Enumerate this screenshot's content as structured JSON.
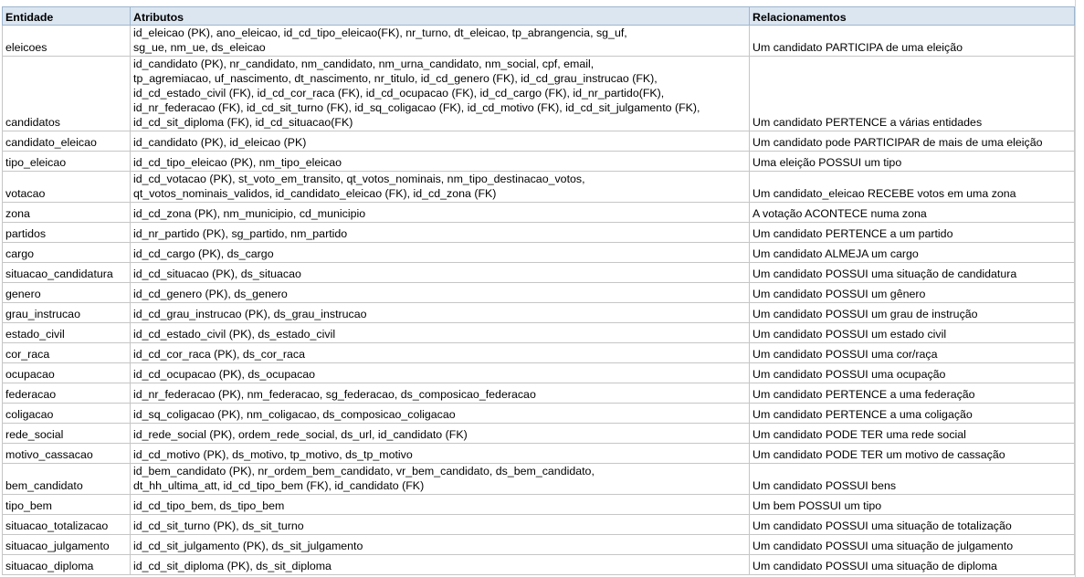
{
  "header": {
    "entity": "Entidade",
    "attributes": "Atributos",
    "relationships": "Relacionamentos"
  },
  "rows": [
    {
      "entity": "eleicoes",
      "attributes": [
        "id_eleicao (PK), ano_eleicao, id_cd_tipo_eleicao(FK), nr_turno, dt_eleicao, tp_abrangencia, sg_uf,",
        "sg_ue, nm_ue, ds_eleicao"
      ],
      "relationship": "Um candidato PARTICIPA de uma eleição"
    },
    {
      "entity": "candidatos",
      "attributes": [
        "id_candidato (PK), nr_candidato, nm_candidato, nm_urna_candidato, nm_social, cpf, email,",
        "tp_agremiacao, uf_nascimento, dt_nascimento, nr_titulo, id_cd_genero (FK), id_cd_grau_instrucao (FK),",
        "id_cd_estado_civil (FK), id_cd_cor_raca (FK), id_cd_ocupacao (FK), id_cd_cargo (FK), id_nr_partido(FK),",
        "id_nr_federacao (FK), id_cd_sit_turno (FK), id_sq_coligacao (FK), id_cd_motivo (FK), id_cd_sit_julgamento (FK),",
        "id_cd_sit_diploma (FK), id_cd_situacao(FK)"
      ],
      "relationship": "Um candidato PERTENCE a várias entidades"
    },
    {
      "entity": "candidato_eleicao",
      "attributes": [
        "id_candidato (PK), id_eleicao (PK)"
      ],
      "relationship": "Um candidato pode PARTICIPAR de mais de uma eleição"
    },
    {
      "entity": "tipo_eleicao",
      "attributes": [
        "id_cd_tipo_eleicao (PK), nm_tipo_eleicao"
      ],
      "relationship": "Uma eleição POSSUI um tipo"
    },
    {
      "entity": "votacao",
      "attributes": [
        "id_cd_votacao (PK),  st_voto_em_transito, qt_votos_nominais, nm_tipo_destinacao_votos,",
        "qt_votos_nominais_validos, id_candidato_eleicao (FK), id_cd_zona (FK)"
      ],
      "relationship": "Um candidato_eleicao RECEBE votos em uma zona"
    },
    {
      "entity": "zona",
      "attributes": [
        "id_cd_zona (PK), nm_municipio, cd_municipio"
      ],
      "relationship": "A votação ACONTECE numa zona"
    },
    {
      "entity": "partidos",
      "attributes": [
        "id_nr_partido (PK), sg_partido, nm_partido"
      ],
      "relationship": "Um candidato PERTENCE a um partido"
    },
    {
      "entity": "cargo",
      "attributes": [
        "id_cd_cargo (PK), ds_cargo"
      ],
      "relationship": "Um candidato ALMEJA um cargo"
    },
    {
      "entity": "situacao_candidatura",
      "attributes": [
        "id_cd_situacao (PK), ds_situacao"
      ],
      "relationship": "Um candidato POSSUI uma situação de candidatura"
    },
    {
      "entity": "genero",
      "attributes": [
        "id_cd_genero (PK), ds_genero"
      ],
      "relationship": "Um candidato POSSUI um gênero"
    },
    {
      "entity": "grau_instrucao",
      "attributes": [
        "id_cd_grau_instrucao (PK), ds_grau_instrucao"
      ],
      "relationship": "Um candidato POSSUI um grau de instrução"
    },
    {
      "entity": "estado_civil",
      "attributes": [
        "id_cd_estado_civil (PK), ds_estado_civil"
      ],
      "relationship": "Um candidato POSSUI um estado civil"
    },
    {
      "entity": "cor_raca",
      "attributes": [
        "id_cd_cor_raca (PK), ds_cor_raca"
      ],
      "relationship": "Um candidato POSSUI uma cor/raça"
    },
    {
      "entity": "ocupacao",
      "attributes": [
        "id_cd_ocupacao (PK), ds_ocupacao"
      ],
      "relationship": "Um candidato POSSUI uma ocupação"
    },
    {
      "entity": "federacao",
      "attributes": [
        "id_nr_federacao (PK), nm_federacao, sg_federacao, ds_composicao_federacao"
      ],
      "relationship": "Um candidato PERTENCE a uma federação"
    },
    {
      "entity": "coligacao",
      "attributes": [
        "id_sq_coligacao (PK), nm_coligacao, ds_composicao_coligacao"
      ],
      "relationship": "Um candidato PERTENCE a uma coligação"
    },
    {
      "entity": "rede_social",
      "attributes": [
        "id_rede_social (PK), ordem_rede_social, ds_url, id_candidato (FK)"
      ],
      "relationship": "Um candidato PODE TER uma rede social"
    },
    {
      "entity": "motivo_cassacao",
      "attributes": [
        "id_cd_motivo (PK), ds_motivo, tp_motivo, ds_tp_motivo"
      ],
      "relationship": "Um candidato PODE TER um motivo de cassação"
    },
    {
      "entity": "bem_candidato",
      "attributes": [
        "id_bem_candidato (PK), nr_ordem_bem_candidato, vr_bem_candidato, ds_bem_candidato,",
        "dt_hh_ultima_att, id_cd_tipo_bem (FK), id_candidato (FK)"
      ],
      "relationship": "Um candidato POSSUI bens"
    },
    {
      "entity": "tipo_bem",
      "attributes": [
        "id_cd_tipo_bem, ds_tipo_bem"
      ],
      "relationship": "Um bem POSSUI um tipo"
    },
    {
      "entity": "situacao_totalizacao",
      "attributes": [
        "id_cd_sit_turno (PK), ds_sit_turno"
      ],
      "relationship": "Um candidato POSSUI uma situação de totalização"
    },
    {
      "entity": "situacao_julgamento",
      "attributes": [
        "id_cd_sit_julgamento (PK), ds_sit_julgamento"
      ],
      "relationship": "Um candidato POSSUI uma situação de julgamento"
    },
    {
      "entity": "situacao_diploma",
      "attributes": [
        "id_cd_sit_diploma (PK), ds_sit_diploma"
      ],
      "relationship": "Um candidato POSSUI uma situação de diploma"
    }
  ]
}
